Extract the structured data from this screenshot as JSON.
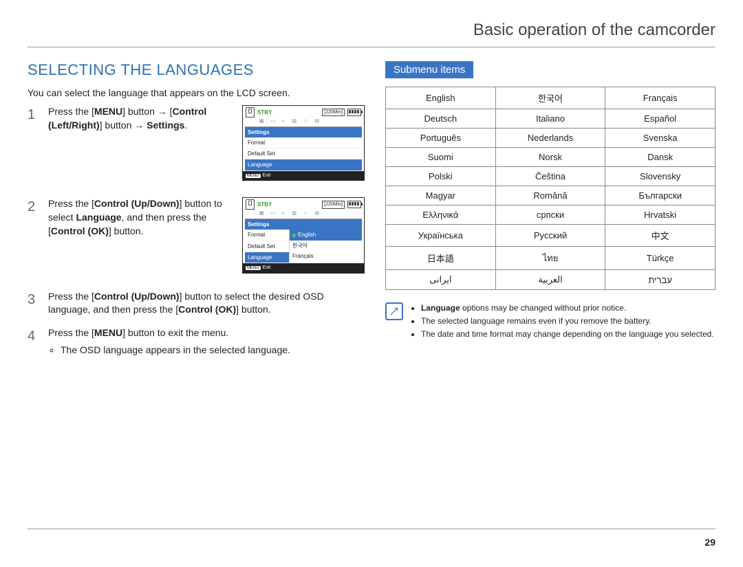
{
  "header": {
    "chapter_title": "Basic operation of the camcorder"
  },
  "left": {
    "section_title": "SELECTING THE LANGUAGES",
    "intro": "You can select the language that appears on the LCD screen.",
    "steps": {
      "s1_num": "1",
      "s1_a": "Press the [",
      "s1_b": "MENU",
      "s1_c": "] button → [",
      "s1_d": "Control (Left/Right)",
      "s1_e": "] button → ",
      "s1_f": "Settings",
      "s1_g": ".",
      "s2_num": "2",
      "s2_a": "Press the [",
      "s2_b": "Control (Up/Down)",
      "s2_c": "] button to select ",
      "s2_d": "Language",
      "s2_e": ", and then press the [",
      "s2_f": "Control (OK)",
      "s2_g": "] button.",
      "s3_num": "3",
      "s3_a": "Press the [",
      "s3_b": "Control (Up/Down)",
      "s3_c": "] button to select the desired OSD language, and then press the [",
      "s3_d": "Control (OK)",
      "s3_e": "] button.",
      "s4_num": "4",
      "s4_a": "Press the [",
      "s4_b": "MENU",
      "s4_c": "] button to exit the menu.",
      "s4_bullet": "The OSD language appears in the selected language."
    },
    "lcd": {
      "stby": "STBY",
      "time": "[220Min]",
      "menu_exit": "Exit",
      "menu_btn": "MENU",
      "screen1": {
        "head": "Settings",
        "items": [
          "Format",
          "Default Set",
          "Language"
        ]
      },
      "screen2": {
        "head": "Settings",
        "left_items": [
          "Format",
          "Default Set",
          "Language"
        ],
        "right_items": [
          "English",
          "한국어",
          "Français"
        ]
      }
    }
  },
  "right": {
    "badge": "Submenu items",
    "languages": [
      [
        "English",
        "한국어",
        "Français"
      ],
      [
        "Deutsch",
        "Italiano",
        "Español"
      ],
      [
        "Português",
        "Nederlands",
        "Svenska"
      ],
      [
        "Suomi",
        "Norsk",
        "Dansk"
      ],
      [
        "Polski",
        "Čeština",
        "Slovensky"
      ],
      [
        "Magyar",
        "Română",
        "Български"
      ],
      [
        "Ελληνικά",
        "српски",
        "Hrvatski"
      ],
      [
        "Українська",
        "Русский",
        "中文"
      ],
      [
        "日本語",
        "ไทย",
        "Türkçe"
      ],
      [
        "ایرانی",
        "العربية",
        "עברית"
      ]
    ],
    "notes": {
      "n1_a": "Language",
      "n1_b": " options may be changed without prior notice.",
      "n2": "The selected language remains even if you remove the battery.",
      "n3": "The date and time format may change depending on the language you selected."
    }
  },
  "page_number": "29"
}
